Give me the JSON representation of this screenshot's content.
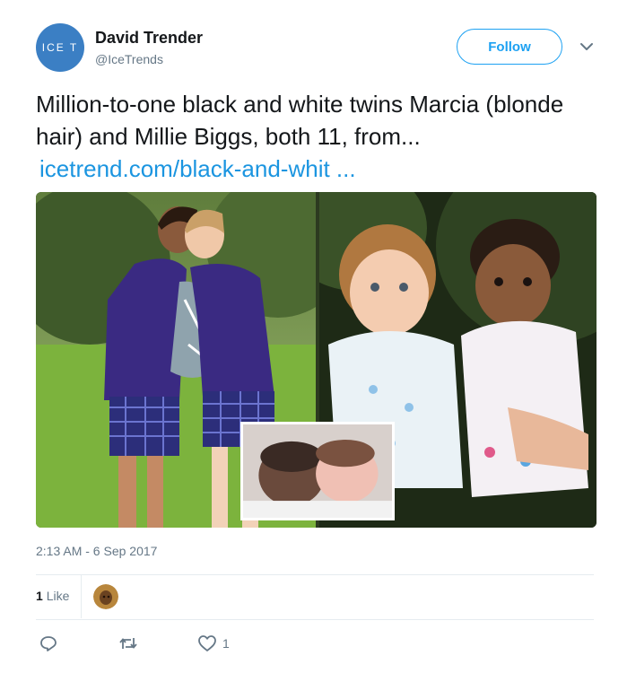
{
  "author": {
    "avatar_text": "ICE T",
    "display_name": "David Trender",
    "handle": "@IceTrends"
  },
  "follow_label": "Follow",
  "tweet": {
    "text": "Million-to-one black and white twins Marcia (blonde hair) and Millie Biggs, both 11, from...",
    "link": "icetrend.com/black-and-whit ..."
  },
  "timestamp": "2:13 AM - 6 Sep 2017",
  "likes": {
    "count": "1",
    "label": "Like"
  },
  "actions": {
    "reply_icon": "reply-icon",
    "retweet_icon": "retweet-icon",
    "like_icon": "heart-icon",
    "like_count": "1"
  },
  "colors": {
    "accent": "#1da1f2",
    "link": "#1b95e0",
    "muted": "#657786",
    "avatar_bg": "#3b7fc4"
  }
}
